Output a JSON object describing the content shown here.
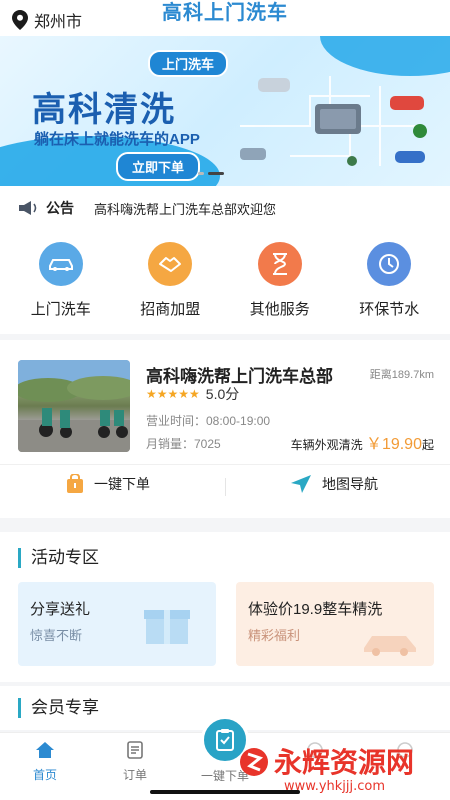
{
  "header": {
    "location": "郑州市",
    "title": "高科上门洗车"
  },
  "banner": {
    "bubble": "上门洗车",
    "headline": "高科清洗",
    "slogan": "躺在床上就能洗车的APP",
    "cta": "立即下单"
  },
  "notice": {
    "label": "公告",
    "text": "高科嗨洗帮上门洗车总部欢迎您"
  },
  "quick_menu": [
    {
      "label": "上门洗车",
      "color": "#5aa9e6"
    },
    {
      "label": "招商加盟",
      "color": "#f5a742"
    },
    {
      "label": "其他服务",
      "color": "#f27a4b"
    },
    {
      "label": "环保节水",
      "color": "#5b8fe0"
    }
  ],
  "store": {
    "name": "高科嗨洗帮上门洗车总部",
    "distance": "距离189.7km",
    "stars": "★★★★★",
    "rating": "5.0分",
    "hours": "营业时间：08:00-19:00",
    "sales": "月销量：7025",
    "service": "车辆外观清洗",
    "price": "￥19.90",
    "price_suffix": "起",
    "action_order": "一键下单",
    "action_nav": "地图导航"
  },
  "activity": {
    "title": "活动专区",
    "cards": [
      {
        "title": "分享送礼",
        "subtitle": "惊喜不断"
      },
      {
        "title": "体验价19.9整车精洗",
        "subtitle": "精彩福利"
      }
    ]
  },
  "member": {
    "title": "会员专享"
  },
  "tabs": [
    {
      "label": "首页",
      "active": true
    },
    {
      "label": "订单",
      "active": false
    },
    {
      "label": "一键下单",
      "active": false
    },
    {
      "label": "",
      "active": false
    },
    {
      "label": "",
      "active": false
    }
  ],
  "watermark": {
    "main": "永辉资源网",
    "url": "www.yhkjjj.com"
  },
  "colors": {
    "brand": "#2c8ad1",
    "accent": "#29a3c6",
    "price": "#f29b36"
  }
}
